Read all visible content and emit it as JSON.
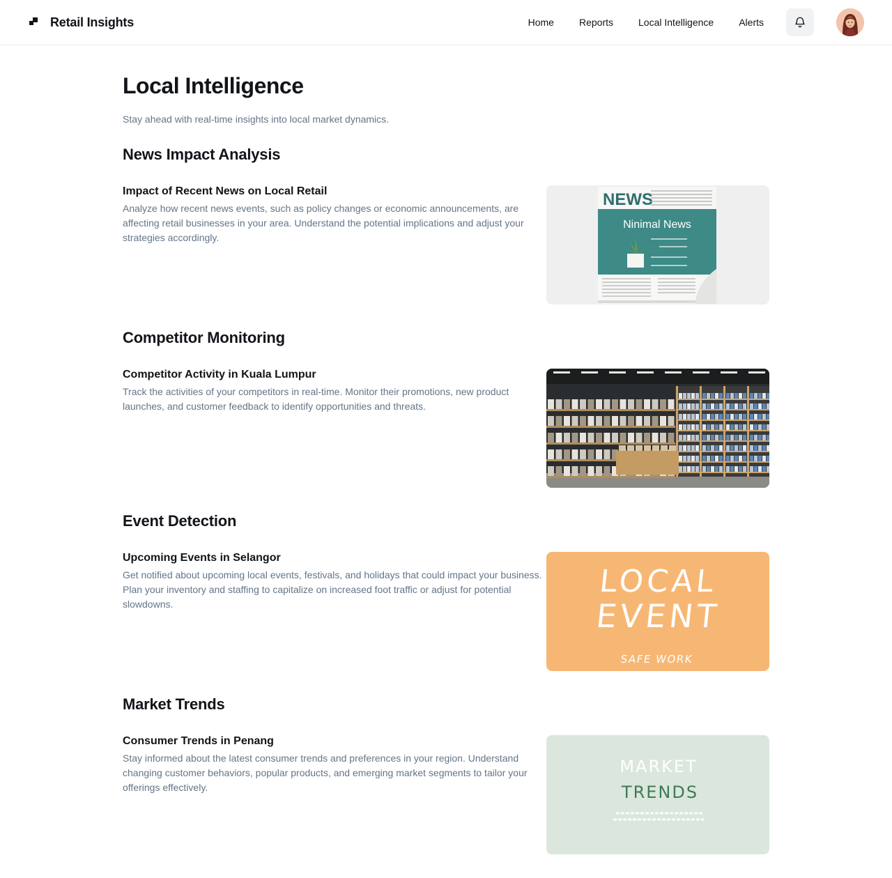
{
  "header": {
    "brand": "Retail Insights",
    "nav": [
      "Home",
      "Reports",
      "Local Intelligence",
      "Alerts"
    ]
  },
  "page": {
    "title": "Local Intelligence",
    "subtitle": "Stay ahead with real-time insights into local market dynamics."
  },
  "sections": [
    {
      "heading": "News Impact Analysis",
      "card_title": "Impact of Recent News on Local Retail",
      "card_desc": "Analyze how recent news events, such as policy changes or economic announcements, are affecting retail businesses in your area. Understand the potential implications and adjust your strategies accordingly.",
      "image": {
        "masthead": "NEWS",
        "headline": "Ninimal News"
      }
    },
    {
      "heading": "Competitor Monitoring",
      "card_title": "Competitor Activity in Kuala Lumpur",
      "card_desc": "Track the activities of your competitors in real-time. Monitor their promotions, new product launches, and customer feedback to identify opportunities and threats."
    },
    {
      "heading": "Event Detection",
      "card_title": "Upcoming Events in Selangor",
      "card_desc": "Get notified about upcoming local events, festivals, and holidays that could impact your business. Plan your inventory and staffing to capitalize on increased foot traffic or adjust for potential slowdowns.",
      "image": {
        "line1": "LOCAL",
        "line2": "EVENT",
        "caption": "SAFE WORK"
      }
    },
    {
      "heading": "Market Trends",
      "card_title": "Consumer Trends in Penang",
      "card_desc": "Stay informed about the latest consumer trends and preferences in your region. Understand changing customer behaviors, popular products, and emerging market segments to tailor your offerings effectively.",
      "image": {
        "line1": "MARKET",
        "line2": "TRENDS"
      }
    }
  ],
  "colors": {
    "accent_teal": "#3d8a87",
    "event_orange": "#f7b774",
    "trend_green": "#dbe7dc",
    "muted_text": "#637588"
  },
  "icons": [
    "brand-logo-icon",
    "bell-icon",
    "avatar"
  ]
}
